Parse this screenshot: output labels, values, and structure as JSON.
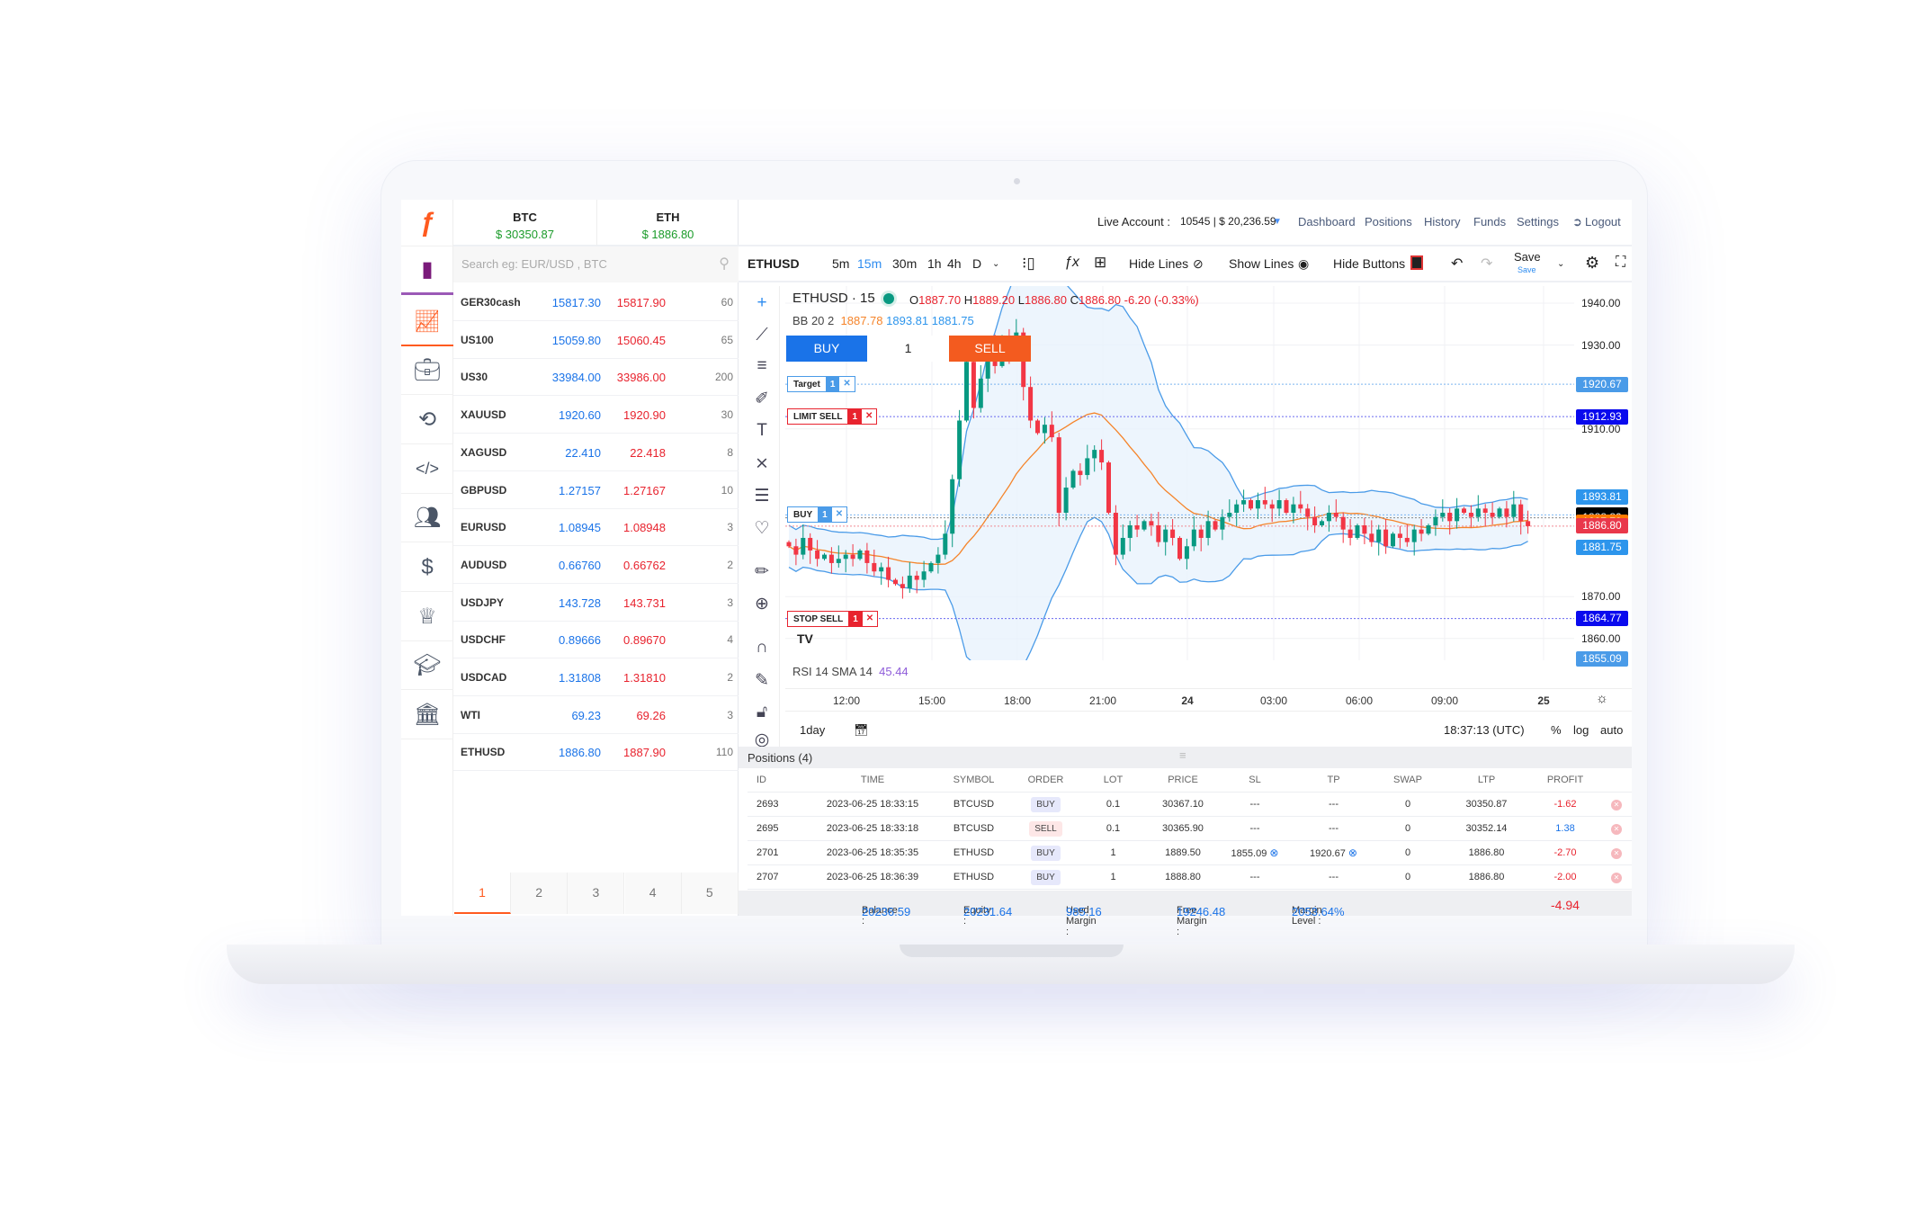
{
  "header": {
    "tabs": [
      {
        "symbol": "BTC",
        "price": "$ 30350.87"
      },
      {
        "symbol": "ETH",
        "price": "$ 1886.80"
      }
    ],
    "account_label": "Live Account :",
    "account_value": "10545 | $ 20,236.59",
    "nav": [
      "Dashboard",
      "Positions",
      "History",
      "Funds",
      "Settings",
      "Logout"
    ]
  },
  "sidebar": {
    "icons": [
      "bookmark-icon",
      "chart-line-icon",
      "briefcase-icon",
      "history-icon",
      "code-icon",
      "users-icon",
      "dollar-icon",
      "crown-icon",
      "graduation-cap-icon",
      "bank-icon"
    ],
    "active_color": "#ff5a1f",
    "bookmark_color": "#7a1a7a"
  },
  "watchlist": {
    "search_placeholder": "Search eg: EUR/USD , BTC",
    "rows": [
      {
        "symbol": "GER30cash",
        "bid": "15817.30",
        "ask": "15817.90",
        "spread": "60"
      },
      {
        "symbol": "US100",
        "bid": "15059.80",
        "ask": "15060.45",
        "spread": "65"
      },
      {
        "symbol": "US30",
        "bid": "33984.00",
        "ask": "33986.00",
        "spread": "200"
      },
      {
        "symbol": "XAUUSD",
        "bid": "1920.60",
        "ask": "1920.90",
        "spread": "30"
      },
      {
        "symbol": "XAGUSD",
        "bid": "22.410",
        "ask": "22.418",
        "spread": "8"
      },
      {
        "symbol": "GBPUSD",
        "bid": "1.27157",
        "ask": "1.27167",
        "spread": "10"
      },
      {
        "symbol": "EURUSD",
        "bid": "1.08945",
        "ask": "1.08948",
        "spread": "3"
      },
      {
        "symbol": "AUDUSD",
        "bid": "0.66760",
        "ask": "0.66762",
        "spread": "2"
      },
      {
        "symbol": "USDJPY",
        "bid": "143.728",
        "ask": "143.731",
        "spread": "3"
      },
      {
        "symbol": "USDCHF",
        "bid": "0.89666",
        "ask": "0.89670",
        "spread": "4"
      },
      {
        "symbol": "USDCAD",
        "bid": "1.31808",
        "ask": "1.31810",
        "spread": "2"
      },
      {
        "symbol": "WTI",
        "bid": "69.23",
        "ask": "69.26",
        "spread": "3"
      },
      {
        "symbol": "ETHUSD",
        "bid": "1886.80",
        "ask": "1887.90",
        "spread": "110"
      }
    ],
    "pages": [
      "1",
      "2",
      "3",
      "4",
      "5"
    ],
    "active_page": "1"
  },
  "toolbar": {
    "symbol": "ETHUSD",
    "intervals": [
      "5m",
      "15m",
      "30m",
      "1h",
      "4h",
      "D"
    ],
    "active_interval": "15m",
    "hide_lines": "Hide Lines",
    "show_lines": "Show Lines",
    "hide_buttons": "Hide Buttons",
    "save": "Save",
    "save_sub": "Save"
  },
  "chart": {
    "title": "ETHUSD · 15",
    "o_label": "O",
    "o": "1887.70",
    "h_label": "H",
    "h": "1889.20",
    "l_label": "L",
    "l": "1886.80",
    "c_label": "C",
    "c": "1886.80",
    "change": "-6.20 (-0.33%)",
    "bb_label": "BB 20 2",
    "bb_mid": "1887.78",
    "bb_up": "1893.81",
    "bb_low": "1881.75",
    "buy": "BUY",
    "qty": "1",
    "sell": "SELL",
    "tags": [
      {
        "label": "Target",
        "qty": "1",
        "price": 1920.67,
        "color": "#4a9be8"
      },
      {
        "label": "LIMIT SELL",
        "qty": "1",
        "price": 1912.93,
        "color": "#e8232e"
      },
      {
        "label": "BUY",
        "qty": "1",
        "price": 1889.5,
        "color": "#4a9be8"
      },
      {
        "label": "STOP SELL",
        "qty": "1",
        "price": 1864.77,
        "color": "#e8232e"
      }
    ],
    "price_ticks": [
      "1940.00",
      "1930.00",
      "1910.00",
      "1870.00",
      "1860.00"
    ],
    "price_labels": [
      {
        "v": "1920.67",
        "bg": "#4a9be8"
      },
      {
        "v": "1912.93",
        "bg": "#0a0aee"
      },
      {
        "v": "1893.81",
        "bg": "#2d95ec"
      },
      {
        "v": "1889.50",
        "bg": "#000000"
      },
      {
        "v": "1888.80",
        "bg": "#000000"
      },
      {
        "v": "1887.78",
        "bg": "#ff7a00"
      },
      {
        "v": "1886.80",
        "bg": "#e9384b"
      },
      {
        "v": "1881.75",
        "bg": "#2d95ec"
      },
      {
        "v": "1864.77",
        "bg": "#0a0aee"
      },
      {
        "v": "1855.09",
        "bg": "#4a9be8"
      }
    ],
    "time_ticks": [
      "12:00",
      "15:00",
      "18:00",
      "21:00",
      "24",
      "03:00",
      "06:00",
      "09:00",
      "25"
    ],
    "rsi_label": "RSI 14 SMA 14",
    "rsi_value": "45.44",
    "range": "1day",
    "clock": "18:37:13 (UTC)",
    "pct": "%",
    "log": "log",
    "auto": "auto",
    "up_color": "#089981",
    "down_color": "#f23645",
    "closes": [
      1882,
      1880,
      1884,
      1881,
      1879,
      1880,
      1878,
      1879,
      1880,
      1879,
      1881,
      1878,
      1876,
      1877,
      1874,
      1873,
      1872,
      1875,
      1874,
      1876,
      1878,
      1880,
      1885,
      1898,
      1912,
      1926,
      1915,
      1922,
      1930,
      1925,
      1932,
      1928,
      1933,
      1920,
      1912,
      1909,
      1911,
      1908,
      1890,
      1896,
      1900,
      1899,
      1903,
      1905,
      1902,
      1890,
      1880,
      1884,
      1887,
      1886,
      1888,
      1887,
      1883,
      1886,
      1884,
      1879,
      1882,
      1886,
      1884,
      1888,
      1886,
      1889,
      1890,
      1892,
      1893,
      1891,
      1893,
      1892,
      1891,
      1893,
      1890,
      1892,
      1891,
      1889,
      1887,
      1888,
      1890,
      1889,
      1886,
      1884,
      1887,
      1885,
      1883,
      1886,
      1882,
      1885,
      1884,
      1883,
      1886,
      1885,
      1887,
      1889,
      1890,
      1888,
      1891,
      1890,
      1889,
      1891,
      1890,
      1889,
      1891,
      1889,
      1892,
      1888,
      1886.8
    ]
  },
  "positions": {
    "title": "Positions (4)",
    "columns": [
      "ID",
      "TIME",
      "SYMBOL",
      "ORDER",
      "LOT",
      "PRICE",
      "SL",
      "TP",
      "SWAP",
      "LTP",
      "PROFIT"
    ],
    "rows": [
      {
        "id": "2693",
        "time": "2023-06-25 18:33:15",
        "symbol": "BTCUSD",
        "order": "BUY",
        "lot": "0.1",
        "price": "30367.10",
        "sl": "---",
        "tp": "---",
        "swap": "0",
        "ltp": "30350.87",
        "profit": "-1.62"
      },
      {
        "id": "2695",
        "time": "2023-06-25 18:33:18",
        "symbol": "BTCUSD",
        "order": "SELL",
        "lot": "0.1",
        "price": "30365.90",
        "sl": "---",
        "tp": "---",
        "swap": "0",
        "ltp": "30352.14",
        "profit": "1.38"
      },
      {
        "id": "2701",
        "time": "2023-06-25 18:35:35",
        "symbol": "ETHUSD",
        "order": "BUY",
        "lot": "1",
        "price": "1889.50",
        "sl": "1855.09",
        "tp": "1920.67",
        "swap": "0",
        "ltp": "1886.80",
        "profit": "-2.70"
      },
      {
        "id": "2707",
        "time": "2023-06-25 18:36:39",
        "symbol": "ETHUSD",
        "order": "BUY",
        "lot": "1",
        "price": "1888.80",
        "sl": "---",
        "tp": "---",
        "swap": "0",
        "ltp": "1886.80",
        "profit": "-2.00"
      }
    ],
    "footer": {
      "balance_label": "Balance :",
      "balance": "20236.59",
      "equity_label": "Equity :",
      "equity": "20231.64",
      "used_label": "Used Margin :",
      "used": "985.16",
      "free_label": "Free Margin :",
      "free": "19246.48",
      "level_label": "Margin Level :",
      "level": "2053.64%",
      "total": "-4.94"
    }
  }
}
